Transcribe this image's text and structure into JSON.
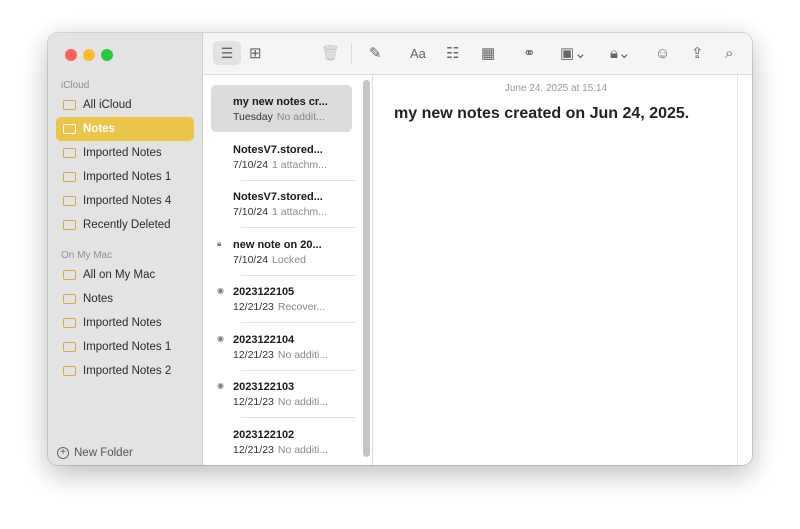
{
  "sidebar": {
    "icloud_header": "iCloud",
    "icloud_items": [
      {
        "label": "All iCloud"
      },
      {
        "label": "Notes"
      },
      {
        "label": "Imported Notes"
      },
      {
        "label": "Imported Notes 1"
      },
      {
        "label": "Imported Notes 4"
      },
      {
        "label": "Recently Deleted"
      }
    ],
    "mac_header": "On My Mac",
    "mac_items": [
      {
        "label": "All on My Mac"
      },
      {
        "label": "Notes"
      },
      {
        "label": "Imported Notes"
      },
      {
        "label": "Imported Notes 1"
      },
      {
        "label": "Imported Notes 2"
      }
    ],
    "new_folder": "New Folder"
  },
  "toolbar": {
    "font_label": "Aa"
  },
  "notes": [
    {
      "title": "my new notes cr...",
      "date": "Tuesday",
      "preview": "No addit..."
    },
    {
      "title": "NotesV7.stored...",
      "date": "7/10/24",
      "preview": "1 attachm..."
    },
    {
      "title": "NotesV7.stored...",
      "date": "7/10/24",
      "preview": "1 attachm..."
    },
    {
      "title": "new note on 20...",
      "date": "7/10/24",
      "preview": "Locked"
    },
    {
      "title": "2023122105",
      "date": "12/21/23",
      "preview": "Recover..."
    },
    {
      "title": "2023122104",
      "date": "12/21/23",
      "preview": "No additi..."
    },
    {
      "title": "2023122103",
      "date": "12/21/23",
      "preview": "No additi..."
    },
    {
      "title": "2023122102",
      "date": "12/21/23",
      "preview": "No additi..."
    }
  ],
  "editor": {
    "date": "June 24, 2025 at 15:14",
    "title": "my new notes created on Jun 24, 2025."
  }
}
